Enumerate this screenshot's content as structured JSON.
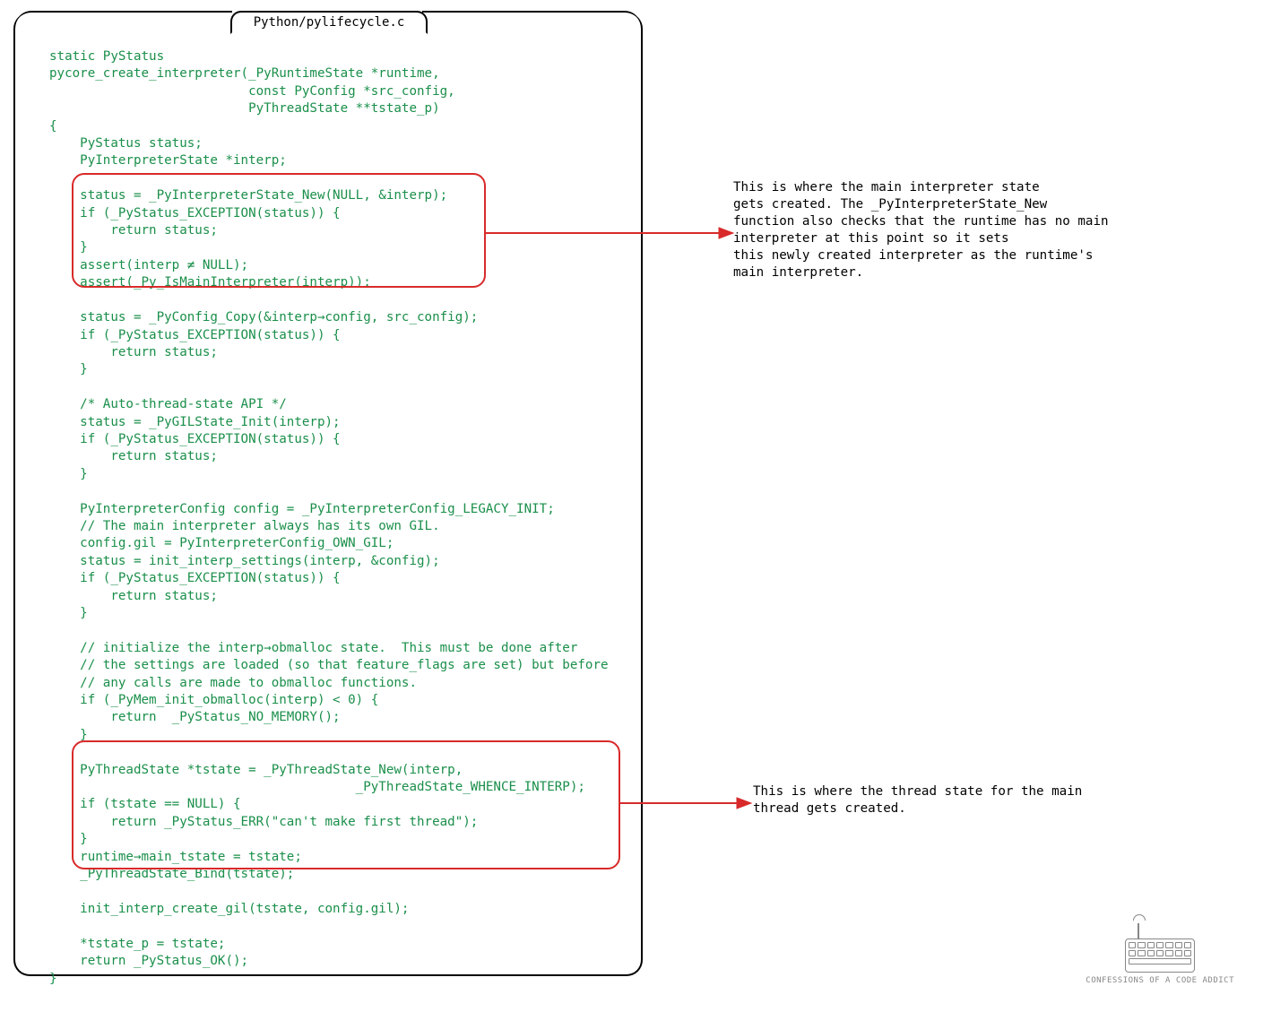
{
  "filename": "Python/pylifecycle.c",
  "code": "static PyStatus\npycore_create_interpreter(_PyRuntimeState *runtime,\n                          const PyConfig *src_config,\n                          PyThreadState **tstate_p)\n{\n    PyStatus status;\n    PyInterpreterState *interp;\n\n    status = _PyInterpreterState_New(NULL, &interp);\n    if (_PyStatus_EXCEPTION(status)) {\n        return status;\n    }\n    assert(interp ≠ NULL);\n    assert(_Py_IsMainInterpreter(interp));\n\n    status = _PyConfig_Copy(&interp→config, src_config);\n    if (_PyStatus_EXCEPTION(status)) {\n        return status;\n    }\n\n    /* Auto-thread-state API */\n    status = _PyGILState_Init(interp);\n    if (_PyStatus_EXCEPTION(status)) {\n        return status;\n    }\n\n    PyInterpreterConfig config = _PyInterpreterConfig_LEGACY_INIT;\n    // The main interpreter always has its own GIL.\n    config.gil = PyInterpreterConfig_OWN_GIL;\n    status = init_interp_settings(interp, &config);\n    if (_PyStatus_EXCEPTION(status)) {\n        return status;\n    }\n\n    // initialize the interp→obmalloc state.  This must be done after\n    // the settings are loaded (so that feature_flags are set) but before\n    // any calls are made to obmalloc functions.\n    if (_PyMem_init_obmalloc(interp) < 0) {\n        return  _PyStatus_NO_MEMORY();\n    }\n\n    PyThreadState *tstate = _PyThreadState_New(interp,\n                                        _PyThreadState_WHENCE_INTERP);\n    if (tstate == NULL) {\n        return _PyStatus_ERR(\"can't make first thread\");\n    }\n    runtime→main_tstate = tstate;\n    _PyThreadState_Bind(tstate);\n\n    init_interp_create_gil(tstate, config.gil);\n\n    *tstate_p = tstate;\n    return _PyStatus_OK();\n}",
  "annotations": {
    "ann1": "This is where the main interpreter state\ngets created. The _PyInterpreterState_New\nfunction also checks that the runtime has no main\ninterpreter at this point so it sets\nthis newly created interpreter as the runtime's\nmain interpreter.",
    "ann2": "This is where the thread state for the main\nthread gets created."
  },
  "logo_caption": "CONFESSIONS OF A CODE ADDICT"
}
